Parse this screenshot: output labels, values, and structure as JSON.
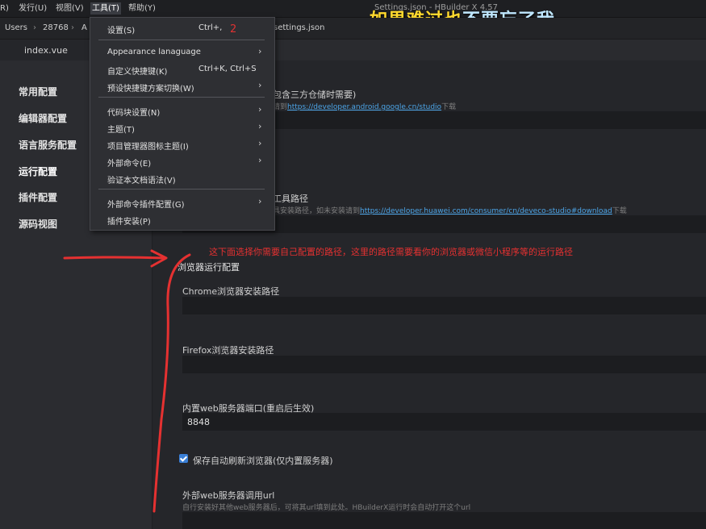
{
  "menubar": {
    "items": [
      {
        "label": "R)"
      },
      {
        "label": "发行(U)"
      },
      {
        "label": "视图(V)"
      },
      {
        "label": "工具(T)"
      },
      {
        "label": "帮助(Y)"
      }
    ],
    "window_title": "Settings.json - HBuilder X 4.57",
    "overlay_caption_a": "如果难过也",
    "overlay_caption_b": "不要忘了我"
  },
  "breadcrumb": {
    "items": [
      "Users",
      "28768",
      "A"
    ],
    "sep": "›",
    "file": "settings.json"
  },
  "tabs": {
    "active": "index.vue"
  },
  "sidebar": {
    "items": [
      {
        "label": "常用配置"
      },
      {
        "label": "编辑器配置"
      },
      {
        "label": "语言服务配置"
      },
      {
        "label": "运行配置"
      },
      {
        "label": "插件配置"
      },
      {
        "label": "源码视图"
      }
    ],
    "active_index": 3
  },
  "dropdown": {
    "items": [
      {
        "label": "设置(S)",
        "shortcut": "Ctrl+,",
        "arrow": ""
      },
      {
        "label": "Appearance lanaguage",
        "shortcut": "",
        "arrow": "›"
      },
      {
        "label": "自定义快捷键(K)",
        "shortcut": "Ctrl+K, Ctrl+S",
        "arrow": ""
      },
      {
        "label": "预设快捷键方案切换(W)",
        "shortcut": "",
        "arrow": "›"
      },
      {
        "label": "代码块设置(N)",
        "shortcut": "",
        "arrow": "›"
      },
      {
        "label": "主题(T)",
        "shortcut": "",
        "arrow": "›"
      },
      {
        "label": "项目管理器图标主题(I)",
        "shortcut": "",
        "arrow": "›"
      },
      {
        "label": "外部命令(E)",
        "shortcut": "",
        "arrow": "›"
      },
      {
        "label": "验证本文档语法(V)",
        "shortcut": "",
        "arrow": ""
      },
      {
        "label": "外部命令插件配置(G)",
        "shortcut": "",
        "arrow": "›"
      },
      {
        "label": "插件安装(P)",
        "shortcut": "",
        "arrow": ""
      }
    ],
    "annotation_number": "2"
  },
  "main": {
    "android": {
      "label_fragment": "包含三方仓储时需要)",
      "hint_prefix": "请到",
      "link": "https://developer.android.google.cn/studio",
      "hint_suffix": "下载"
    },
    "huawei": {
      "label_fragment": "工具路径",
      "hint_prefix": "具安装路径，如未安装请到",
      "link": "https://developer.huawei.com/consumer/cn/deveco-studio#download",
      "hint_suffix": "下载"
    },
    "annotation": "这下面选择你需要自己配置的路径，这里的路径需要看你的浏览器或微信小程序等的运行路径",
    "browser_section_title": "浏览器运行配置",
    "chrome_label": "Chrome浏览器安装路径",
    "chrome_value": "",
    "firefox_label": "Firefox浏览器安装路径",
    "firefox_value": "",
    "port_label": "内置web服务器端口(重启后生效)",
    "port_value": "8848",
    "auto_refresh_label": "保存自动刷新浏览器(仅内置服务器)",
    "auto_refresh_checked": true,
    "external_url_label": "外部web服务器调用url",
    "external_url_hint": "自行安装好其他web服务器后，可将其url填到此处。HBuilderX运行时会自动打开这个url",
    "external_url_value": ""
  },
  "colors": {
    "accent_link": "#4ca5e8",
    "annotation_red": "#e53131",
    "checkbox_blue": "#3a7fd6"
  }
}
